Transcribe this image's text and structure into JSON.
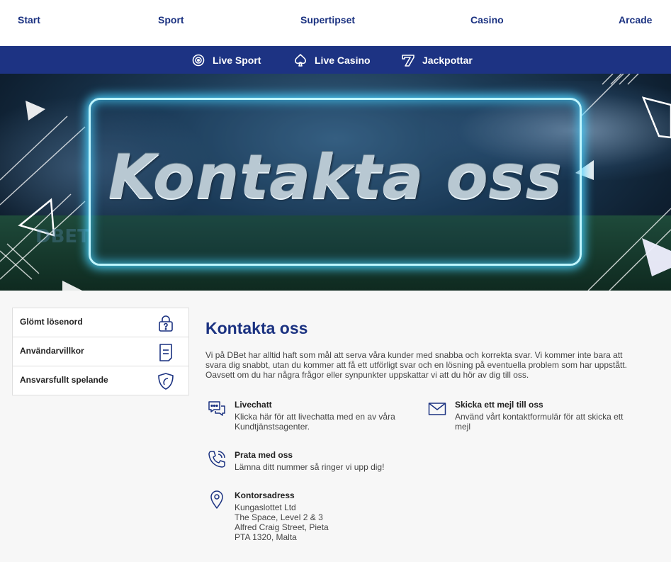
{
  "top_nav": [
    "Start",
    "Sport",
    "Supertipset",
    "Casino",
    "Arcade"
  ],
  "sub_nav": {
    "live_sport": "Live Sport",
    "live_casino": "Live Casino",
    "jackpots": "Jackpottar"
  },
  "hero": {
    "title": "Kontakta oss",
    "watermark": "DBET"
  },
  "sidebar": {
    "forgot_password": "Glömt lösenord",
    "terms": "Användarvillkor",
    "responsible": "Ansvarsfullt spelande"
  },
  "main": {
    "heading": "Kontakta oss",
    "intro": "Vi på DBet har alltid haft som mål att serva våra kunder med snabba och korrekta svar. Vi kommer inte bara att svara dig snabbt, utan du kommer att få ett utförligt svar och en lösning på eventuella problem som har uppstått. Oavsett om du har några frågor eller synpunkter uppskattar vi att du hör av dig till oss.",
    "livechat": {
      "title": "Livechatt",
      "desc": "Klicka här för att livechatta med en av våra Kundtjänstsagenter."
    },
    "email": {
      "title": "Skicka ett mejl till oss",
      "desc": "Använd vårt kontaktformulär för att skicka ett mejl"
    },
    "phone": {
      "title": "Prata med oss",
      "desc": "Lämna ditt nummer så ringer vi upp dig!"
    },
    "address": {
      "title": "Kontorsadress",
      "line1": "Kungaslottet Ltd",
      "line2": "The Space, Level 2 & 3",
      "line3": "Alfred Craig Street, Pieta",
      "line4": "PTA 1320, Malta"
    }
  },
  "colors": {
    "brand": "#1b3281",
    "subnav_bg": "#1d3383",
    "neon": "#46d2ff"
  },
  "icons": [
    "live-sport-icon",
    "spade-icon",
    "seven-icon",
    "lock-question-icon",
    "document-icon",
    "shield-icon",
    "chat-icon",
    "envelope-icon",
    "phone-icon",
    "location-pin-icon"
  ]
}
